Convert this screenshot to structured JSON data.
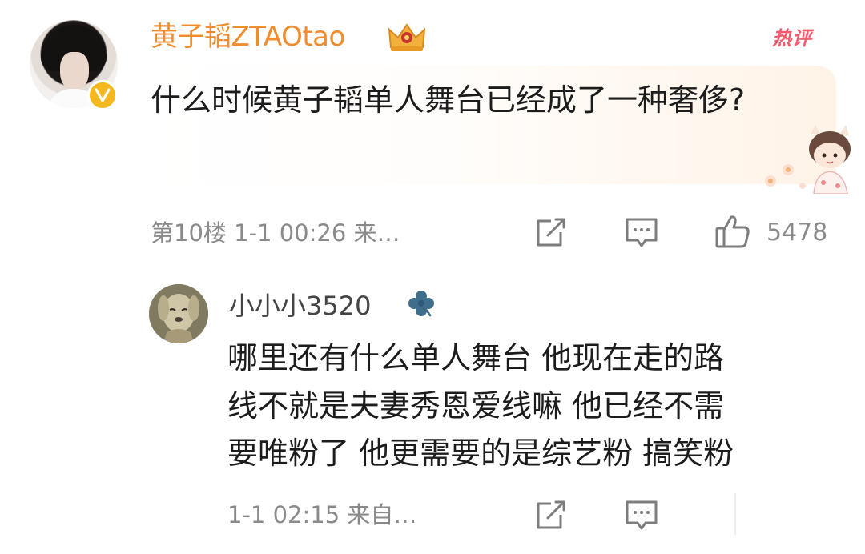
{
  "main_comment": {
    "username": "黄子韬ZTAOtao",
    "badge_text": "热评",
    "text": "什么时候黄子韬单人舞台已经成了一种奢侈?",
    "floor": "第10楼",
    "time": "1-1 00:26",
    "source": "来…",
    "like_count": "5478"
  },
  "reply": {
    "username": "小小小3520",
    "lines": [
      "哪里还有什么单人舞台  他现在走的路",
      "线不就是夫妻秀恩爱线嘛 他已经不需",
      "要唯粉了 他更需要的是综艺粉 搞笑粉"
    ],
    "time": "1-1 02:15",
    "source": "来自…"
  },
  "icons": {
    "share": "share-square-icon",
    "comment": "comment-bubble-icon",
    "like": "thumbs-up-icon",
    "verified": "verified-v-icon",
    "crown": "crown-badge-icon",
    "clover": "clover-icon"
  },
  "colors": {
    "username_orange": "#f08c2c",
    "hot_badge": "#f25a6e",
    "meta_gray": "#8a8a8a",
    "verified_gold": "#f6b81f"
  }
}
